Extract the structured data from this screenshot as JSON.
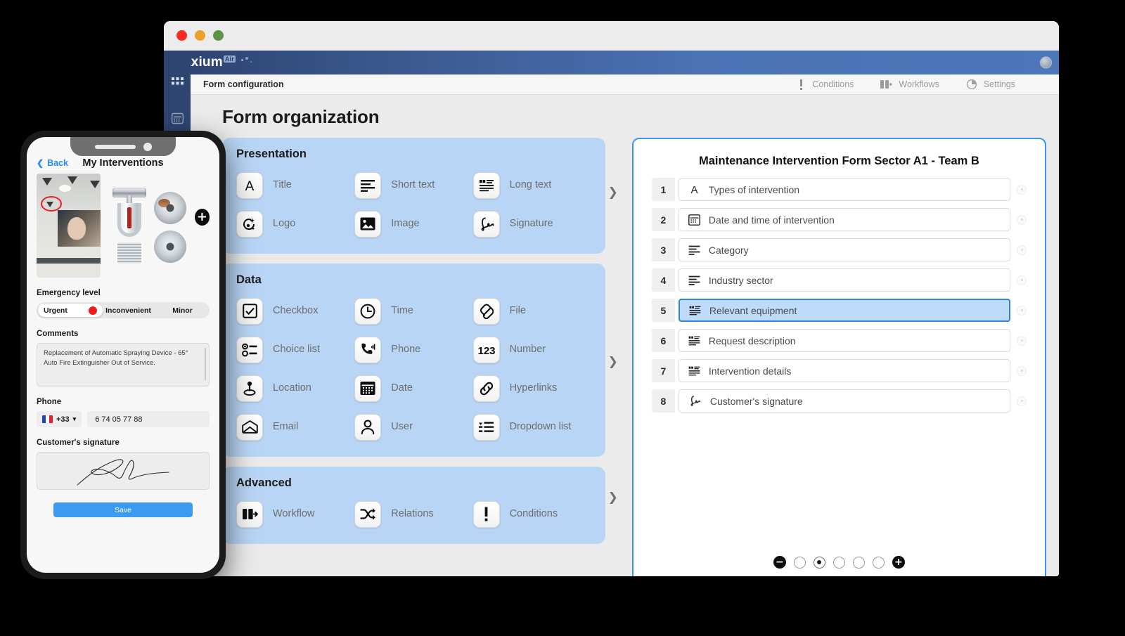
{
  "window": {
    "traffic_lights": [
      "close",
      "minimize",
      "maximize"
    ],
    "brand": {
      "name": "Daxium",
      "suffix": "Air"
    },
    "subheader": {
      "title": "Form configuration",
      "items": [
        {
          "label": "Conditions",
          "icon": "exclamation-icon"
        },
        {
          "label": "Workflows",
          "icon": "workflow-icon"
        },
        {
          "label": "Settings",
          "icon": "gear-icon"
        }
      ]
    },
    "rail": [
      {
        "icon": "grid-apps-icon"
      },
      {
        "icon": "calendar-icon"
      },
      {
        "icon": "pie-chart-icon"
      }
    ]
  },
  "page": {
    "title": "Form organization"
  },
  "palette": {
    "groups": [
      {
        "title": "Presentation",
        "items": [
          {
            "label": "Title",
            "icon": "letter-a-icon"
          },
          {
            "label": "Short text",
            "icon": "short-text-icon"
          },
          {
            "label": "Long text",
            "icon": "long-text-icon"
          },
          {
            "label": "Logo",
            "icon": "logo-icon"
          },
          {
            "label": "Image",
            "icon": "image-icon"
          },
          {
            "label": "Signature",
            "icon": "signature-icon"
          }
        ]
      },
      {
        "title": "Data",
        "items": [
          {
            "label": "Checkbox",
            "icon": "checkbox-icon"
          },
          {
            "label": "Time",
            "icon": "clock-icon"
          },
          {
            "label": "File",
            "icon": "paperclip-icon"
          },
          {
            "label": "Choice list",
            "icon": "choice-list-icon"
          },
          {
            "label": "Phone",
            "icon": "phone-icon"
          },
          {
            "label": "Number",
            "icon": "number-123-icon"
          },
          {
            "label": "Location",
            "icon": "location-pin-icon"
          },
          {
            "label": "Date",
            "icon": "calendar-icon"
          },
          {
            "label": "Hyperlinks",
            "icon": "link-icon"
          },
          {
            "label": "Email",
            "icon": "envelope-icon"
          },
          {
            "label": "User",
            "icon": "user-icon"
          },
          {
            "label": "Dropdown list",
            "icon": "dropdown-list-icon"
          }
        ]
      },
      {
        "title": "Advanced",
        "items": [
          {
            "label": "Workflow",
            "icon": "workflow-icon"
          },
          {
            "label": "Relations",
            "icon": "shuffle-icon"
          },
          {
            "label": "Conditions",
            "icon": "exclamation-icon"
          }
        ]
      }
    ]
  },
  "form_preview": {
    "title": "Maintenance Intervention Form Sector A1 - Team B",
    "rows": [
      {
        "num": "1",
        "label": "Types of intervention",
        "icon": "letter-a-icon",
        "selected": false
      },
      {
        "num": "2",
        "label": "Date and time of intervention",
        "icon": "calendar-icon",
        "selected": false
      },
      {
        "num": "3",
        "label": "Category",
        "icon": "short-text-icon",
        "selected": false
      },
      {
        "num": "4",
        "label": "Industry sector",
        "icon": "short-text-icon",
        "selected": false
      },
      {
        "num": "5",
        "label": "Relevant equipment",
        "icon": "long-text-icon",
        "selected": true
      },
      {
        "num": "6",
        "label": "Request description",
        "icon": "long-text-icon",
        "selected": false
      },
      {
        "num": "7",
        "label": "Intervention details",
        "icon": "long-text-icon",
        "selected": false
      },
      {
        "num": "8",
        "label": "Customer's signature",
        "icon": "signature-icon",
        "selected": false
      }
    ],
    "pager": {
      "remove_label": "−",
      "add_label": "+",
      "dots": 5,
      "active_index": 1
    },
    "reorder": {
      "up": "move-up",
      "down": "move-down"
    }
  },
  "phone": {
    "back_label": "Back",
    "screen_title": "My Interventions",
    "add_photo_label": "+",
    "fields": {
      "emergency_label": "Emergency level",
      "emergency_options": [
        "Urgent",
        "Inconvenient",
        "Minor"
      ],
      "emergency_selected": "Urgent",
      "comments_label": "Comments",
      "comments_value": "Replacement of Automatic Spraying Device - 65° Auto Fire Extinguisher Out of Service.",
      "phone_label": "Phone",
      "phone_country": "+33",
      "phone_value": "6 74 05 77 88",
      "signature_label": "Customer's signature"
    },
    "save_label": "Save"
  },
  "colors": {
    "accent_blue": "#3f95e8",
    "palette_blue": "#b8d5f5",
    "brand_dark": "#2e4471",
    "selected_row": "#bedbfa",
    "urgent_red": "#f11b1b",
    "save_blue": "#3a9bf0"
  }
}
